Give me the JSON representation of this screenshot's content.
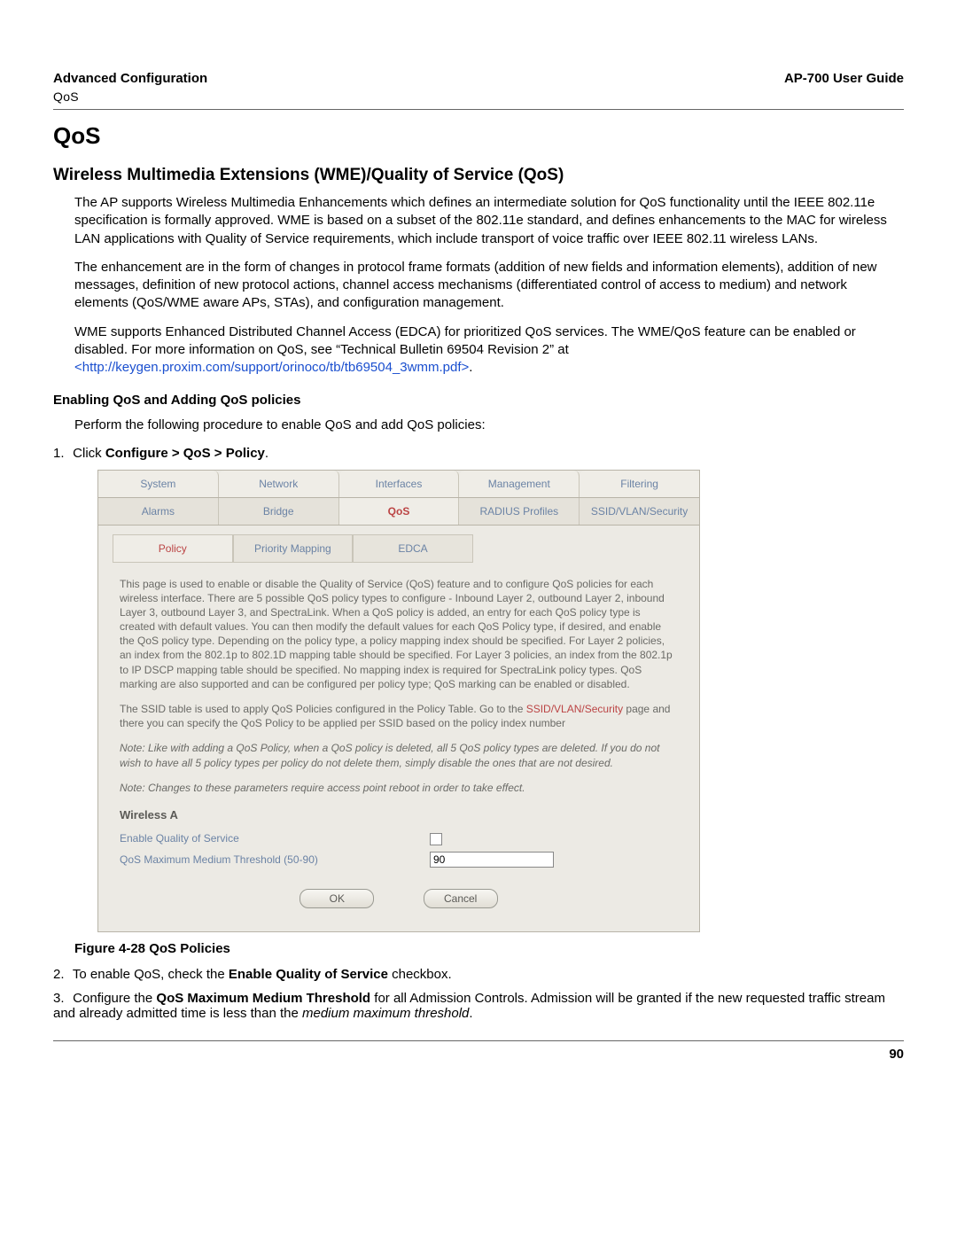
{
  "header": {
    "left": "Advanced Configuration",
    "sub": "QoS",
    "right": "AP-700 User Guide"
  },
  "title": "QoS",
  "section_title": "Wireless Multimedia Extensions (WME)/Quality of Service (QoS)",
  "para1": "The AP supports Wireless Multimedia Enhancements which defines an intermediate solution for QoS functionality until the IEEE 802.11e specification is formally approved. WME is based on a subset of the 802.11e standard, and defines enhancements to the MAC for wireless LAN applications with Quality of Service requirements, which include transport of voice traffic over IEEE 802.11 wireless LANs.",
  "para2": "The enhancement are in the form of changes in protocol frame formats (addition of new fields and information elements), addition of new messages, definition of new protocol actions, channel access mechanisms (differentiated control of access to medium) and network elements (QoS/WME aware APs, STAs), and configuration management.",
  "para3a": "WME supports Enhanced Distributed Channel Access (EDCA) for prioritized QoS services. The WME/QoS feature can be enabled or disabled. For more information on QoS, see “Technical Bulletin 69504 Revision 2” at ",
  "para3_link": "<http://keygen.proxim.com/support/orinoco/tb/tb69504_3wmm.pdf>",
  "para3b": ".",
  "subsection_title": "Enabling QoS and Adding QoS policies",
  "subsection_intro": "Perform the following procedure to enable QoS and add QoS policies:",
  "step1_pre": "1.",
  "step1_text_a": "Click ",
  "step1_text_bold": "Configure > QoS > Policy",
  "step1_text_b": ".",
  "ui": {
    "tabs_row1": [
      "System",
      "Network",
      "Interfaces",
      "Management",
      "Filtering"
    ],
    "tabs_row2": [
      "Alarms",
      "Bridge",
      "QoS",
      "RADIUS Profiles",
      "SSID/VLAN/Security"
    ],
    "tabs_row2_active_index": 2,
    "subtabs": [
      "Policy",
      "Priority Mapping",
      "EDCA"
    ],
    "subtabs_active_index": 0,
    "desc1": "This page is used to enable or disable the Quality of Service (QoS) feature and to configure QoS policies for each wireless interface. There are 5 possible QoS policy types to configure - Inbound Layer 2, outbound Layer 2, inbound Layer 3, outbound Layer 3, and SpectraLink. When a QoS policy is added, an entry for each QoS policy type is created with default values. You can then modify the default values for each QoS Policy type, if desired, and enable the QoS policy type. Depending on the policy type, a policy mapping index should be specified. For Layer 2 policies, an index from the 802.1p to 802.1D mapping table should be specified. For Layer 3 policies, an index from the 802.1p to IP DSCP mapping table should be specified. No mapping index is required for SpectraLink policy types. QoS marking are also supported and can be configured per policy type; QoS marking can be enabled or disabled.",
    "desc2a": "The SSID table is used to apply QoS Policies configured in the Policy Table. Go to the ",
    "desc2_link": "SSID/VLAN/Security",
    "desc2b": " page and there you can specify the QoS Policy to be applied per SSID based on the policy index number",
    "note1": "Note: Like with adding a QoS Policy, when a QoS policy is deleted, all 5 QoS policy types are deleted. If you do not wish to have all 5 policy types per policy do not delete them, simply disable the ones that are not desired.",
    "note2": "Note: Changes to these parameters require access point reboot in order to take effect.",
    "group_head": "Wireless A",
    "field1_label": "Enable Quality of Service",
    "field2_label": "QoS Maximum Medium Threshold (50-90)",
    "field2_value": "90",
    "btn_ok": "OK",
    "btn_cancel": "Cancel"
  },
  "figure_caption": "Figure 4-28 QoS Policies",
  "step2_pre": "2.",
  "step2_a": "To enable QoS, check the ",
  "step2_bold": "Enable Quality of Service",
  "step2_b": " checkbox.",
  "step3_pre": "3.",
  "step3_a": "Configure the ",
  "step3_bold": "QoS Maximum Medium Threshold",
  "step3_b": " for all Admission Controls. Admission will be granted if the new requested traffic stream and already admitted time is less than the ",
  "step3_italic": "medium maximum threshold",
  "step3_c": ".",
  "page_number": "90"
}
